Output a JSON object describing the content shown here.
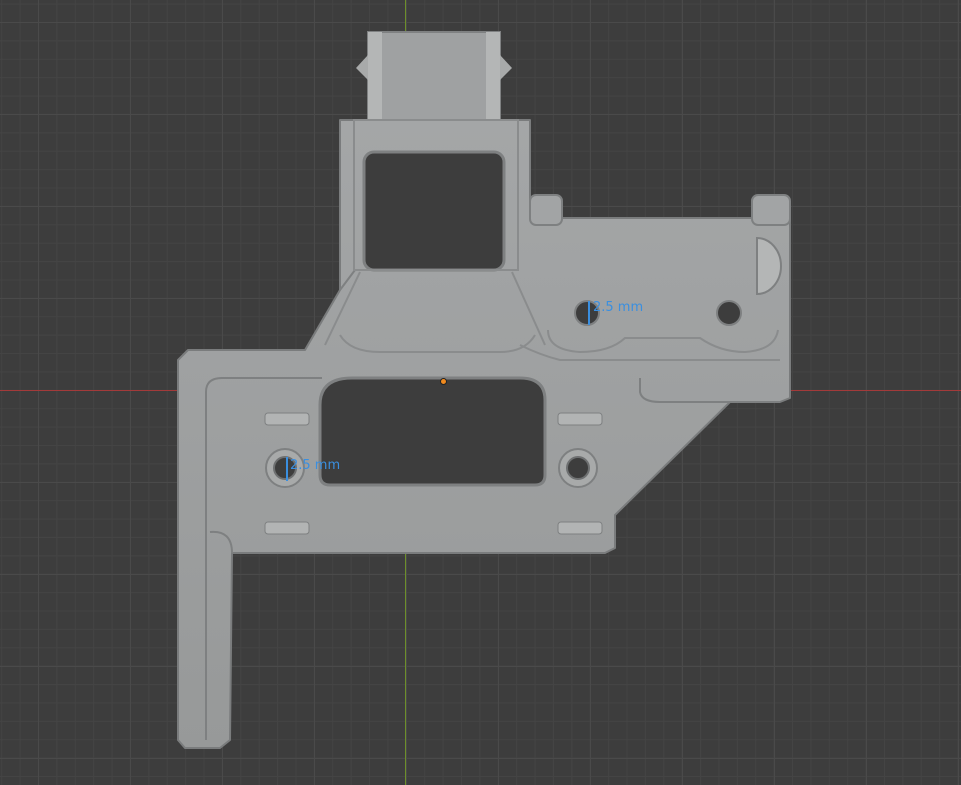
{
  "viewport": {
    "background_color": "#3d3d3d",
    "grid_color": "#4a4a4a",
    "x_axis_color": "#a33a3a",
    "y_axis_color": "#6d8f2a"
  },
  "model": {
    "fill_color": "#9c9e9f",
    "shade_color": "#8a8c8d",
    "highlight_color": "#b8baba"
  },
  "dimensions": [
    {
      "label": "2.5 mm"
    },
    {
      "label": "2.5 mm"
    }
  ],
  "origin_color": "#f08a1e"
}
